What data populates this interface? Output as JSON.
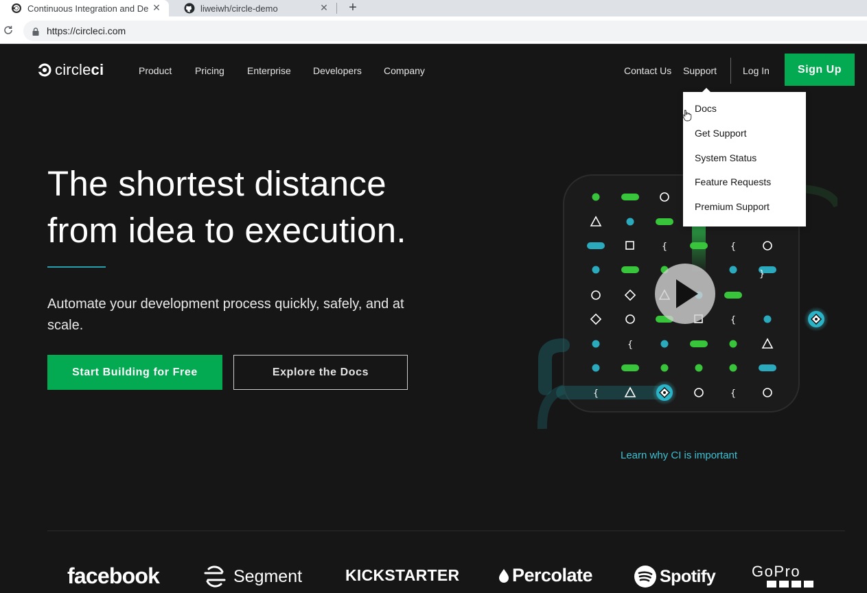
{
  "browser": {
    "tabs": [
      {
        "title": "Continuous Integration and Del",
        "active": true,
        "icon": "circleci-favicon"
      },
      {
        "title": "liweiwh/circle-demo",
        "active": false,
        "icon": "github-favicon"
      }
    ],
    "close_glyph": "✕",
    "new_tab_glyph": "+",
    "url": "https://circleci.com"
  },
  "header": {
    "logo": {
      "regular": "circle",
      "bold": "ci"
    },
    "nav_left": [
      "Product",
      "Pricing",
      "Enterprise",
      "Developers",
      "Company"
    ],
    "nav_right": {
      "contact": "Contact Us",
      "support": "Support",
      "login": "Log In",
      "signup": "Sign Up"
    }
  },
  "support_menu": {
    "items": [
      "Docs",
      "Get Support",
      "System Status",
      "Feature Requests",
      "Premium Support"
    ]
  },
  "hero": {
    "headline_line1": "The shortest distance",
    "headline_line2": "from idea to execution.",
    "subtext": "Automate your development process quickly, safely, and at scale.",
    "cta_primary": "Start Building for Free",
    "cta_secondary": "Explore the Docs",
    "learn_link": "Learn why CI is important"
  },
  "customers": {
    "logos": [
      {
        "name": "facebook",
        "icon": "none"
      },
      {
        "name": "Segment",
        "icon": "segment-icon"
      },
      {
        "name": "KICKSTARTER",
        "icon": "none"
      },
      {
        "name": "Percolate",
        "icon": "drop-icon"
      },
      {
        "name": "Spotify",
        "icon": "spotify-icon"
      },
      {
        "name": "GoPro",
        "icon": "none"
      }
    ]
  },
  "colors": {
    "background": "#161616",
    "brand_green": "#04aa51",
    "accent_teal": "#3fc1d3",
    "dot_green": "#39c53b",
    "dot_teal": "#2ba9bd"
  }
}
